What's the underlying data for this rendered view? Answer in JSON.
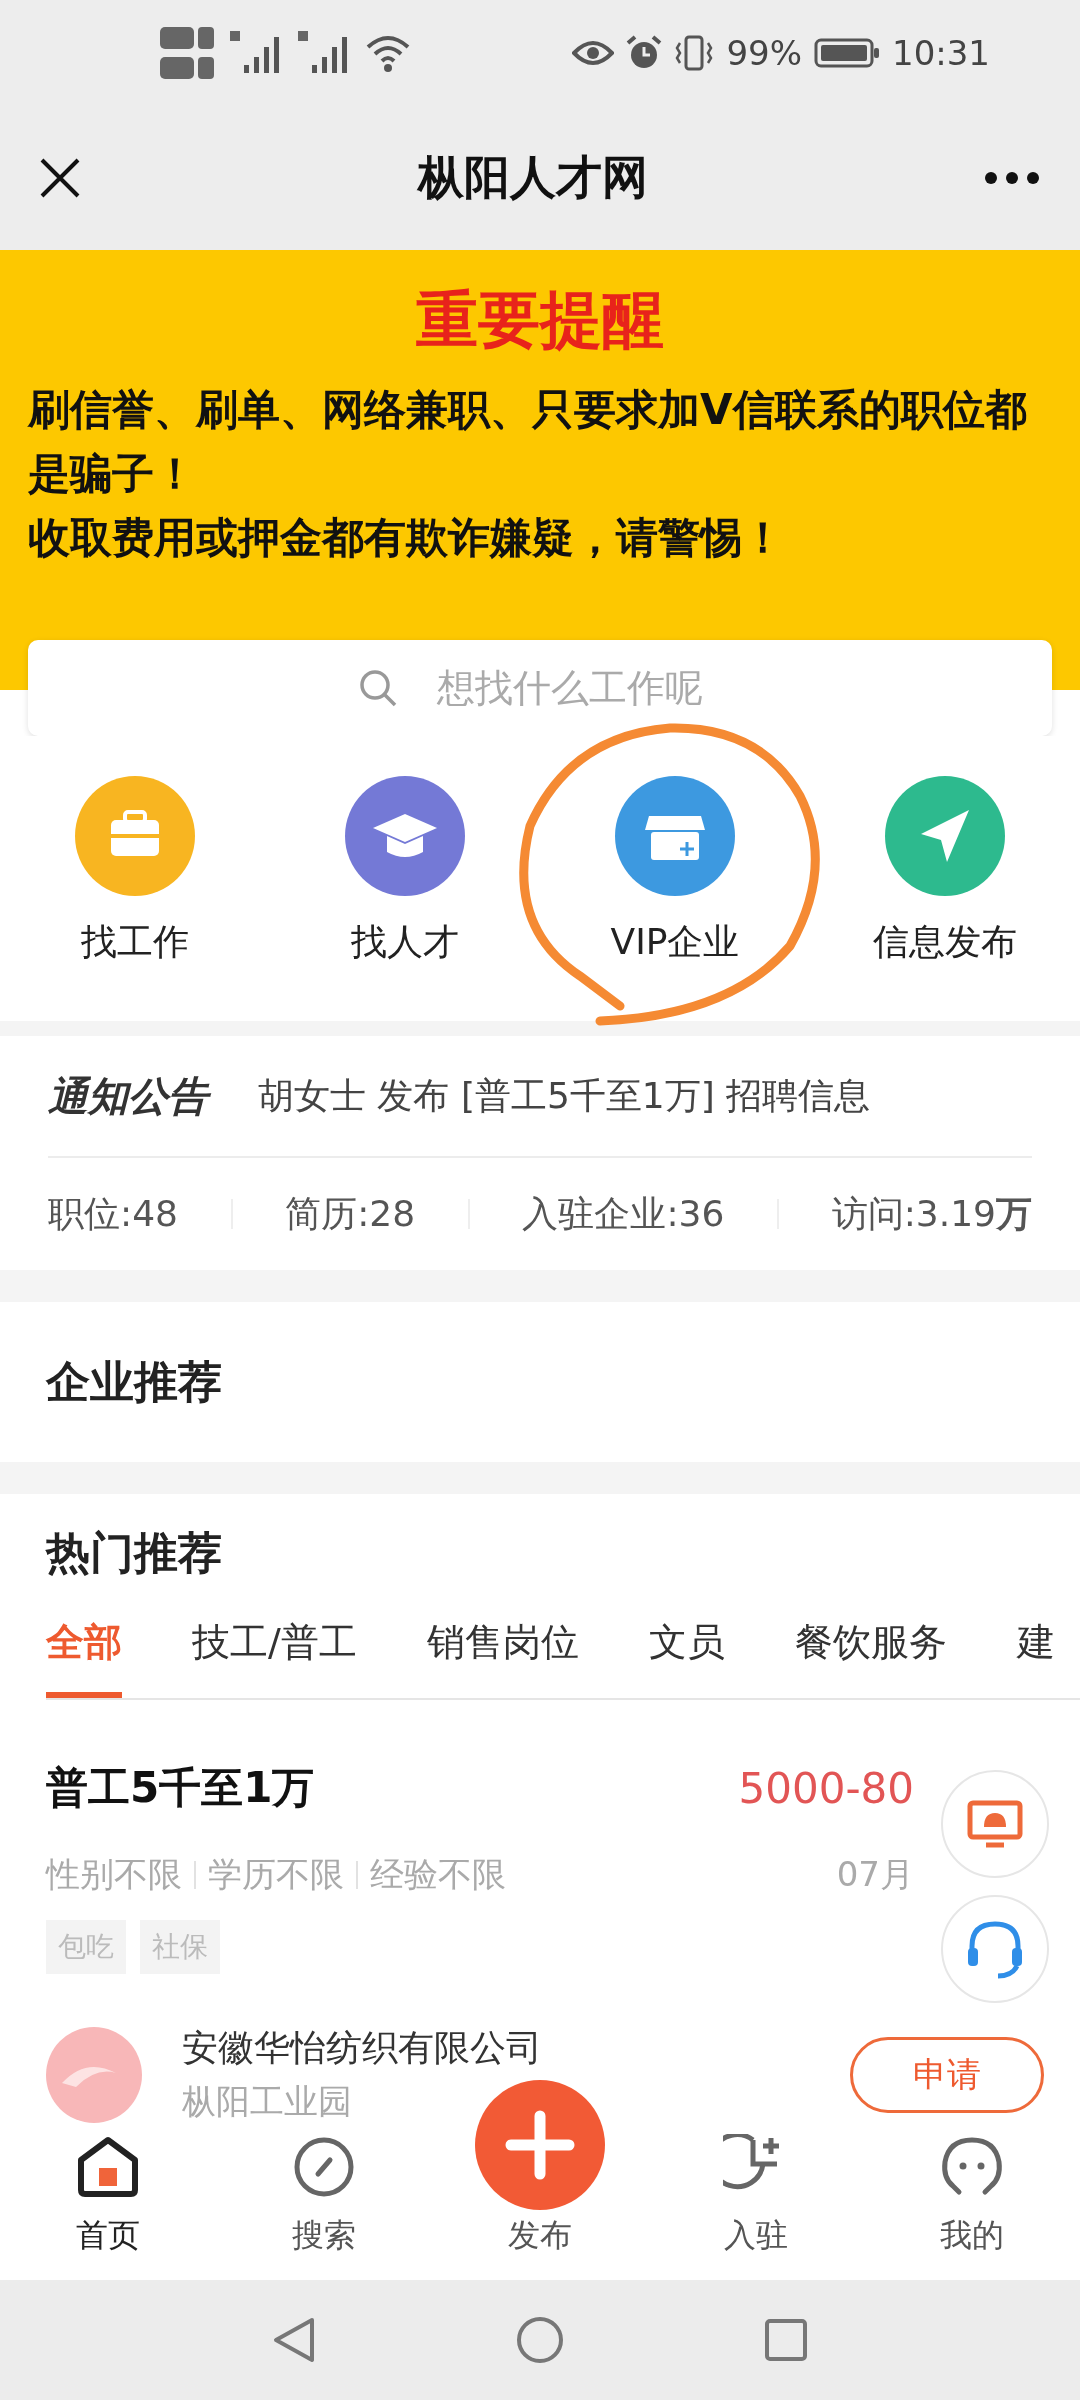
{
  "status_bar": {
    "battery": "99%",
    "time": "10:31"
  },
  "top_bar": {
    "title": "枞阳人才网"
  },
  "warning_banner": {
    "title": "重要提醒",
    "lines": [
      "刷信誉、刷单、网络兼职、只要求加V信联系的职位都是骗子！",
      "收取费用或押金都有欺诈嫌疑，请警惕！"
    ]
  },
  "search": {
    "placeholder": "想找什么工作呢"
  },
  "shortcuts": [
    {
      "kind": "briefcase",
      "label": "找工作"
    },
    {
      "kind": "graduate",
      "label": "找人才"
    },
    {
      "kind": "shop",
      "label": "VIP企业"
    },
    {
      "kind": "send",
      "label": "信息发布"
    }
  ],
  "notice": {
    "badge": "通知公告",
    "text": "胡女士 发布 [普工5千至1万] 招聘信息"
  },
  "stats": [
    {
      "text": "职位:48"
    },
    {
      "text": "简历:28"
    },
    {
      "text": "入驻企业:36"
    },
    {
      "text": "访问:3.19**万**"
    }
  ],
  "company_section": {
    "title": "企业推荐"
  },
  "hot_section": {
    "title": "热门推荐",
    "tabs": [
      {
        "label": "全部",
        "selected": true
      },
      {
        "label": "技工/普工",
        "selected": false
      },
      {
        "label": "销售岗位",
        "selected": false
      },
      {
        "label": "文员",
        "selected": false
      },
      {
        "label": "餐饮服务",
        "selected": false
      },
      {
        "label": "建",
        "selected": false
      }
    ],
    "jobs": [
      {
        "title": "普工5千至1万",
        "salary": "5000-80",
        "requirements": [
          "性别不限",
          "学历不限",
          "经验不限"
        ],
        "date": "07月",
        "tags": [
          "包吃",
          "社保"
        ],
        "company": "安徽华怡纺织有限公司",
        "location": "枞阳工业园",
        "action": "申请"
      }
    ]
  },
  "bottom_nav": [
    {
      "kind": "home",
      "label": "首页",
      "selected": true
    },
    {
      "kind": "compass",
      "label": "搜索",
      "selected": false
    },
    {
      "kind": "plus",
      "label": "发布",
      "selected": false
    },
    {
      "kind": "chart",
      "label": "入驻",
      "selected": false
    },
    {
      "kind": "face",
      "label": "我的",
      "selected": false
    }
  ]
}
